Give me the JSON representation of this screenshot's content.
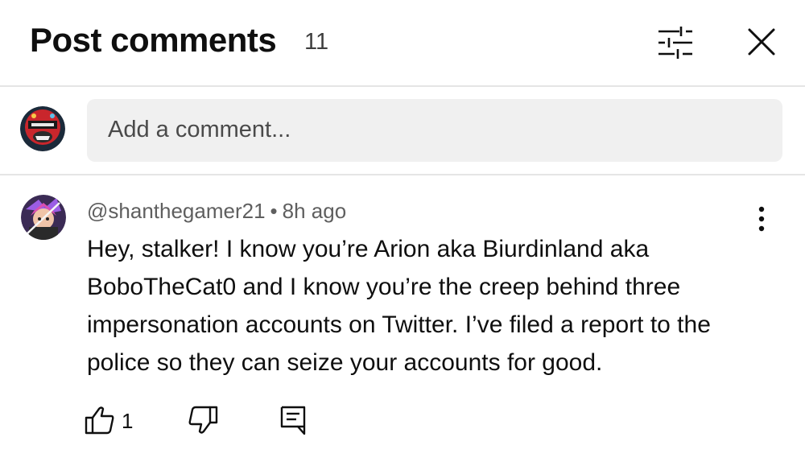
{
  "header": {
    "title": "Post comments",
    "count": "11",
    "filter_icon": "sliders-icon",
    "close_icon": "close-icon"
  },
  "composer": {
    "placeholder": "Add a comment...",
    "avatar_icon": "user-avatar"
  },
  "comments": [
    {
      "author": "@shanthegamer21",
      "separator": "•",
      "time": "8h ago",
      "text": "Hey, stalker! I know you’re Arion aka Biurdinland aka BoboTheCat0 and I know you’re the creep behind three impersonation accounts on Twitter. I’ve filed a report to the police so they can seize your accounts for good.",
      "likes": "1",
      "icons": {
        "like": "thumbs-up-icon",
        "dislike": "thumbs-down-icon",
        "reply": "reply-icon",
        "more": "more-vert-icon"
      }
    }
  ],
  "colors": {
    "text": "#0f0f0f",
    "secondary_text": "#5f5f5f",
    "input_bg": "#f0f0f0",
    "divider": "#e5e5e5"
  }
}
